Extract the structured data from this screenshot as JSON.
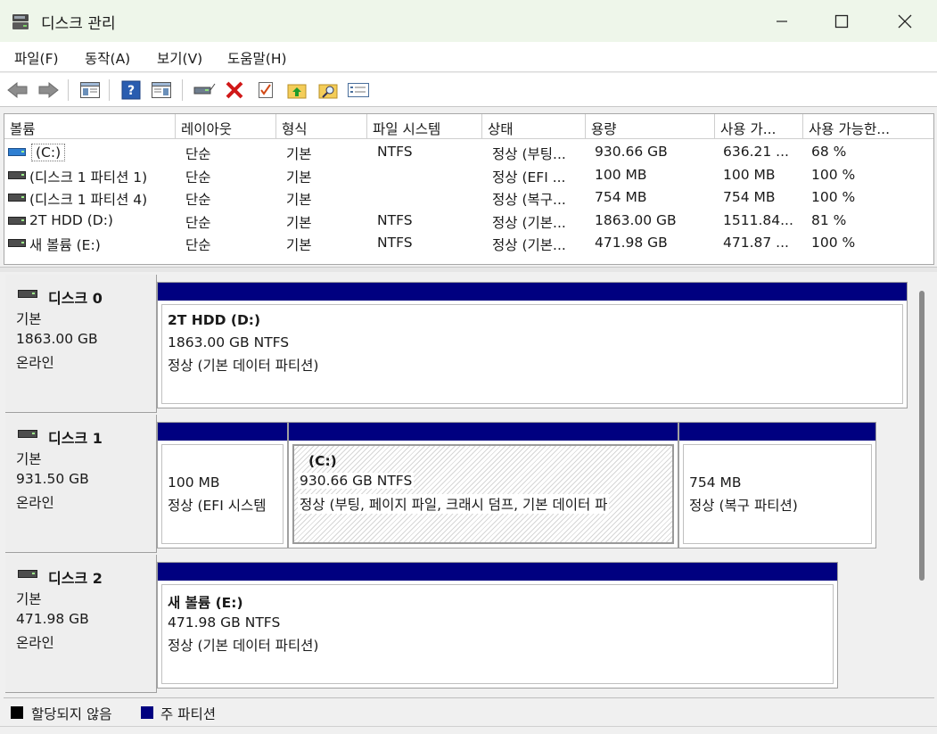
{
  "window": {
    "title": "디스크 관리"
  },
  "menu": [
    "파일(F)",
    "동작(A)",
    "보기(V)",
    "도움말(H)"
  ],
  "toolbar": {
    "icons": [
      "back-arrow-icon",
      "forward-arrow-icon",
      "console-tree-icon",
      "help-icon",
      "properties-view-icon",
      "connect-drive-icon",
      "delete-icon",
      "checklist-icon",
      "up-folder-icon",
      "search-folder-icon",
      "settings-list-icon"
    ]
  },
  "volume_list": {
    "columns": [
      "볼륨",
      "레이아웃",
      "형식",
      "파일 시스템",
      "상태",
      "용량",
      "사용 가...",
      "사용 가능한..."
    ],
    "rows": [
      {
        "volume": "(C:)",
        "layout": "단순",
        "type": "기본",
        "fs": "NTFS",
        "status": "정상 (부팅...",
        "capacity": "930.66 GB",
        "free": "636.21 ...",
        "pct": "68 %"
      },
      {
        "volume": "(디스크 1 파티션 1)",
        "layout": "단순",
        "type": "기본",
        "fs": "",
        "status": "정상 (EFI ...",
        "capacity": "100 MB",
        "free": "100 MB",
        "pct": "100 %"
      },
      {
        "volume": "(디스크 1 파티션 4)",
        "layout": "단순",
        "type": "기본",
        "fs": "",
        "status": "정상 (복구...",
        "capacity": "754 MB",
        "free": "754 MB",
        "pct": "100 %"
      },
      {
        "volume": "2T HDD (D:)",
        "layout": "단순",
        "type": "기본",
        "fs": "NTFS",
        "status": "정상 (기본...",
        "capacity": "1863.00 GB",
        "free": "1511.84...",
        "pct": "81 %"
      },
      {
        "volume": "새 볼륨 (E:)",
        "layout": "단순",
        "type": "기본",
        "fs": "NTFS",
        "status": "정상 (기본...",
        "capacity": "471.98 GB",
        "free": "471.87 ...",
        "pct": "100 %"
      }
    ]
  },
  "disks": [
    {
      "name": "디스크 0",
      "kind": "기본",
      "size": "1863.00 GB",
      "state": "온라인",
      "partitions": [
        {
          "title": "2T HDD  (D:)",
          "line1": "1863.00 GB NTFS",
          "line2": "정상 (기본 데이터 파티션)"
        }
      ]
    },
    {
      "name": "디스크 1",
      "kind": "기본",
      "size": "931.50 GB",
      "state": "온라인",
      "partitions": [
        {
          "title": "",
          "line1": "100 MB",
          "line2": "정상 (EFI 시스템"
        },
        {
          "title": "(C:)",
          "line1": "930.66 GB NTFS",
          "line2": "정상 (부팅, 페이지 파일, 크래시 덤프, 기본 데이터 파"
        },
        {
          "title": "",
          "line1": "754 MB",
          "line2": "정상 (복구 파티션)"
        }
      ]
    },
    {
      "name": "디스크 2",
      "kind": "기본",
      "size": "471.98 GB",
      "state": "온라인",
      "partitions": [
        {
          "title": "새 볼륨  (E:)",
          "line1": "471.98 GB NTFS",
          "line2": "정상 (기본 데이터 파티션)"
        }
      ]
    }
  ],
  "legend": [
    {
      "label": "할당되지 않음",
      "color": "#000000"
    },
    {
      "label": "주 파티션",
      "color": "#000080"
    }
  ],
  "colors": {
    "primary_partition": "#000080",
    "titlebar": "#eef6ea"
  }
}
